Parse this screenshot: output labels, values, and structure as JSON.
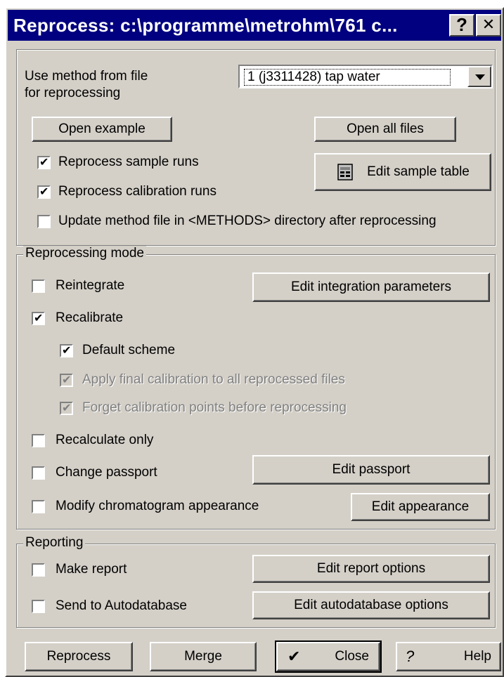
{
  "window": {
    "title": "Reprocess: c:\\programme\\metrohm\\761 c...",
    "help_glyph": "?",
    "close_glyph": "✕"
  },
  "top": {
    "method_label_line1": "Use method from file",
    "method_label_line2": "for reprocessing",
    "method_value": "1  (j3311428)  tap water",
    "open_example": "Open example",
    "open_all_files": "Open all files",
    "reprocess_sample_runs": "Reprocess sample runs",
    "reprocess_calibration_runs": "Reprocess calibration runs",
    "edit_sample_table": "Edit sample table",
    "update_method_file": "Update method file in <METHODS> directory after reprocessing",
    "checks": {
      "sample": true,
      "calibration": true,
      "update": false
    }
  },
  "mode": {
    "group_label": "Reprocessing mode",
    "reintegrate": "Reintegrate",
    "edit_integration": "Edit integration parameters",
    "recalibrate": "Recalibrate",
    "default_scheme": "Default scheme",
    "apply_final": "Apply final calibration to all reprocessed files",
    "forget_points": "Forget calibration points before reprocessing",
    "recalculate_only": "Recalculate only",
    "change_passport": "Change passport",
    "edit_passport": "Edit passport",
    "modify_appearance": "Modify chromatogram appearance",
    "edit_appearance": "Edit appearance"
  },
  "reporting": {
    "group_label": "Reporting",
    "make_report": "Make report",
    "edit_report_options": "Edit report options",
    "send_autodatabase": "Send to Autodatabase",
    "edit_autodatabase_options": "Edit autodatabase options"
  },
  "footer": {
    "reprocess": "Reprocess",
    "merge": "Merge",
    "close": "Close",
    "help": "Help",
    "close_icon_glyph": "✔",
    "help_icon_glyph": "?"
  }
}
